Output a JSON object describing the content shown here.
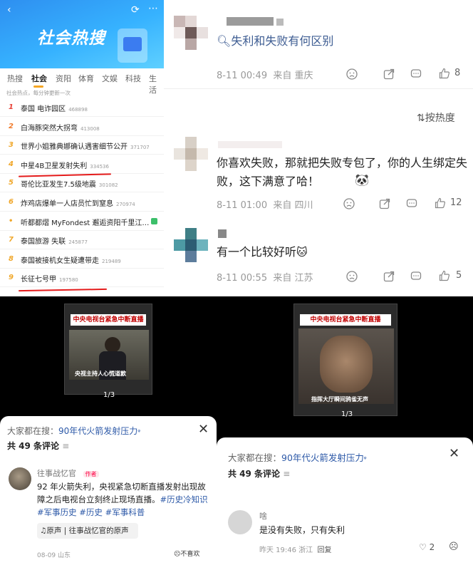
{
  "hot_list": {
    "banner_title": "社会热搜",
    "tabs": [
      "热搜",
      "社会",
      "资阳",
      "体育",
      "文娱",
      "科技",
      "生活"
    ],
    "active_tab": "社会",
    "note": "社会热点，每分钟更新一次",
    "items": [
      {
        "rank": "1",
        "text": "泰国 电诈园区",
        "count": "468898",
        "rank_color": "#e8443a"
      },
      {
        "rank": "2",
        "text": "白海豚突然大拐弯",
        "count": "413008",
        "rank_color": "#f07a2a"
      },
      {
        "rank": "3",
        "text": "世界小姐雅典娜确认遇害细节公开",
        "count": "371707",
        "rank_color": "#f0a72a"
      },
      {
        "rank": "4",
        "text": "中星4B卫星发射失利",
        "count": "334536",
        "rank_color": "#f0a72a"
      },
      {
        "rank": "5",
        "text": "哥伦比亚发生7.5级地震",
        "count": "301082",
        "rank_color": "#f0a72a"
      },
      {
        "rank": "6",
        "text": "炸鸡店爆单一人店员忙到窒息",
        "count": "270974",
        "rank_color": "#f0a72a"
      },
      {
        "rank": "•",
        "text": "听都都熠 MyFondest 邂逅资阳千里江…",
        "count": "",
        "rank_color": "#f0a72a"
      },
      {
        "rank": "7",
        "text": "泰国旅游 失联",
        "count": "245877",
        "rank_color": "#f0a72a"
      },
      {
        "rank": "8",
        "text": "泰国被接机女生疑遭带走",
        "count": "219489",
        "rank_color": "#f0a72a"
      },
      {
        "rank": "9",
        "text": "长征七号甲",
        "count": "197580",
        "rank_color": "#f0a72a"
      }
    ]
  },
  "comments_panel": {
    "search_query": "失利和失败有何区别",
    "sort_label": "按热度",
    "post": {
      "time": "8-11 00:49",
      "location": "来自 重庆",
      "likes": "8"
    },
    "comments": [
      {
        "text": "你喜欢失败，那就把失败专包了，你的人生绑定失败，这下满意了哈！",
        "time": "8-11 01:00",
        "location": "来自 四川",
        "likes": "12"
      },
      {
        "text": "有一个比较好听",
        "time": "8-11 00:55",
        "location": "来自 江苏",
        "likes": "5"
      }
    ]
  },
  "video_left": {
    "banner": "中央电视台紧急中断直播",
    "caption": "央视主持人心慌道歉",
    "page": "1/3",
    "search_prefix": "大家都在搜：",
    "search_term": "90年代火箭发射压力",
    "comment_count": "共 49 条评论",
    "comment": {
      "author": "往事战忆官",
      "author_badge": "作者",
      "text": "92 年火箭失利，央视紧急切断直播发射出现故障之后电视台立刻终止现场直播。",
      "tags": "#历史冷知识 #军事历史 #历史 #军事科普",
      "audio_label": "原声",
      "audio_title": "往事战忆官的原声",
      "date": "08-09",
      "location": "山东",
      "dislike": "不喜欢"
    }
  },
  "video_right": {
    "banner": "中央电视台紧急中断直播",
    "caption": "指挥大厅瞬间鸦雀无声",
    "page": "1/3",
    "search_prefix": "大家都在搜：",
    "search_term": "90年代火箭发射压力",
    "comment_count": "共 49 条评论",
    "comment": {
      "author": "啥",
      "text": "是没有失败，只有失利",
      "time": "昨天 19:46",
      "location": "浙江",
      "reply": "回复",
      "likes": "2"
    }
  }
}
